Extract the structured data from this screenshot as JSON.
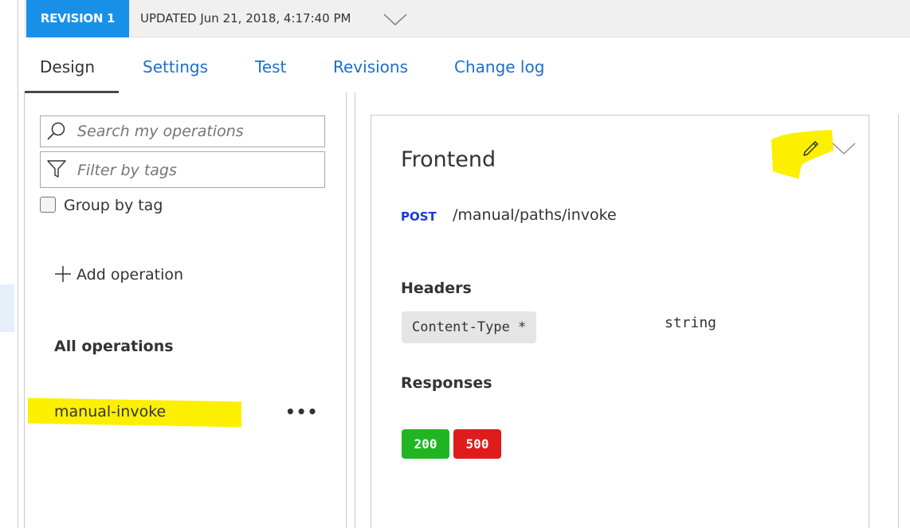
{
  "revision": {
    "badge": "REVISION 1",
    "updated": "UPDATED Jun 21, 2018, 4:17:40 PM"
  },
  "tabs": [
    {
      "label": "Design",
      "active": true
    },
    {
      "label": "Settings",
      "active": false
    },
    {
      "label": "Test",
      "active": false
    },
    {
      "label": "Revisions",
      "active": false
    },
    {
      "label": "Change log",
      "active": false
    }
  ],
  "operations_pane": {
    "search_placeholder": "Search my operations",
    "filter_placeholder": "Filter by tags",
    "group_by_tag_label": "Group by tag",
    "group_by_tag_checked": false,
    "add_operation_label": "Add operation",
    "all_operations_label": "All operations",
    "operations": [
      {
        "name": "manual-invoke",
        "more": "•••"
      }
    ]
  },
  "frontend": {
    "title": "Frontend",
    "method": "POST",
    "path": "/manual/paths/invoke",
    "headers_label": "Headers",
    "headers": [
      {
        "name": "Content-Type *",
        "type": "string"
      }
    ],
    "responses_label": "Responses",
    "responses": [
      "200",
      "500"
    ]
  },
  "colors": {
    "accent": "#1890e8",
    "link": "#1a6fce",
    "highlight": "#fcf000",
    "method_post": "#1a3ad6",
    "response_200": "#21b621",
    "response_500": "#e01b1b"
  },
  "icons": [
    "search-icon",
    "filter-icon",
    "plus-icon",
    "pencil-icon",
    "chevron-down-icon"
  ]
}
